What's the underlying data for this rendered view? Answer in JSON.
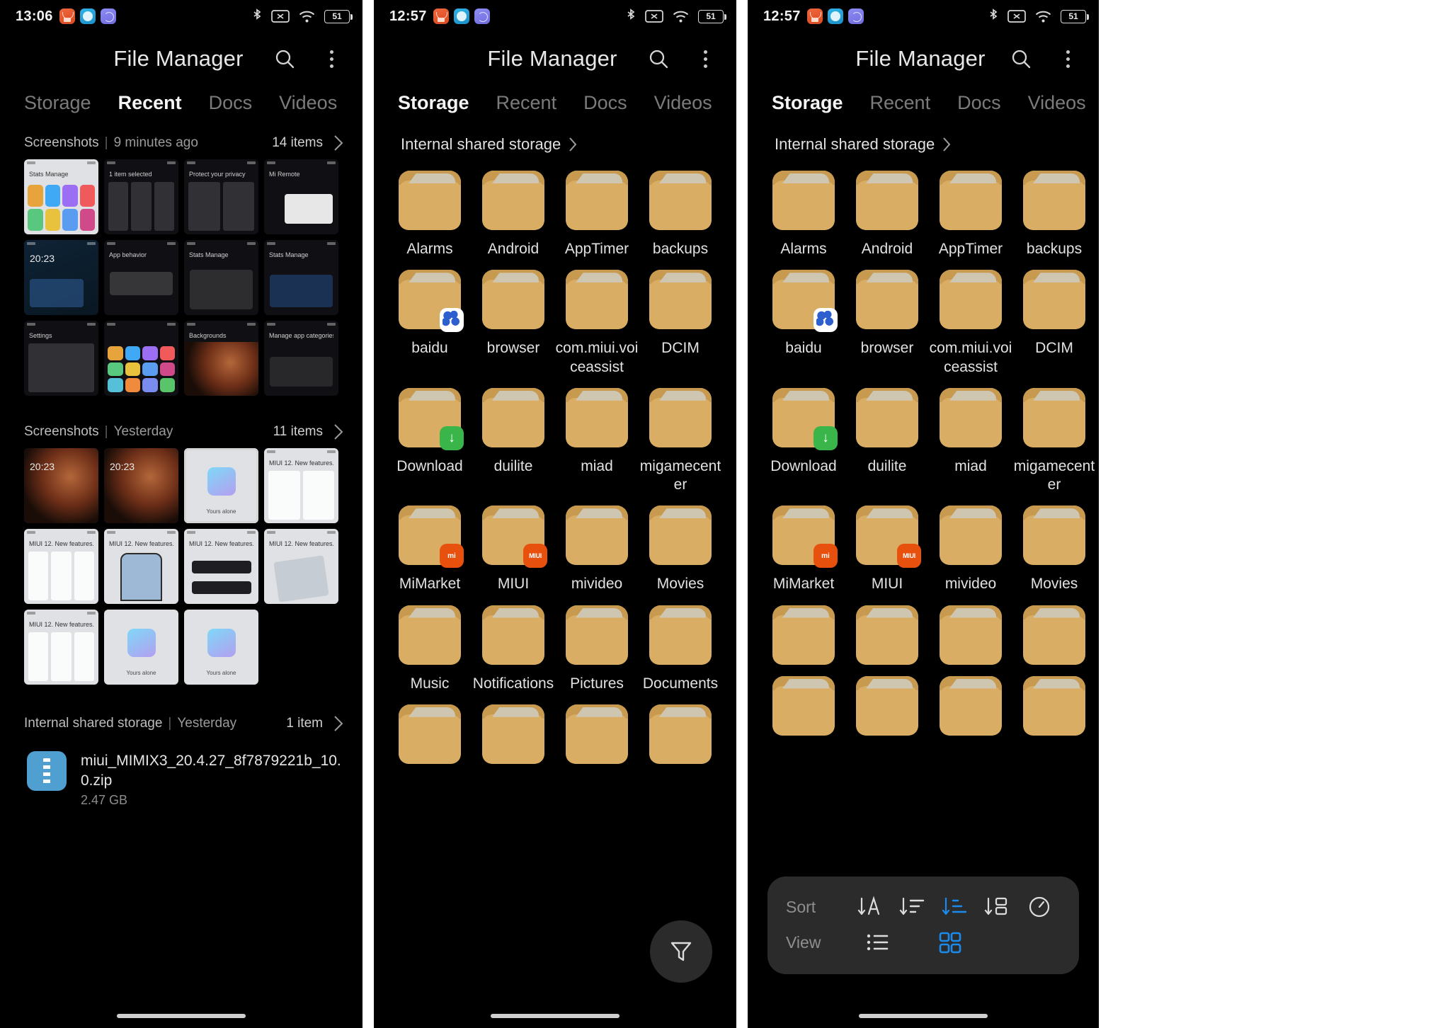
{
  "app": {
    "title": "File Manager"
  },
  "colors": {
    "accent": "#1a8cf0",
    "folder": "#d8ab60",
    "background": "#000000",
    "text": "#e8e8e8"
  },
  "panels": [
    {
      "id": "recent",
      "status": {
        "time": "13:06",
        "battery": "51",
        "icons": [
          "mail-icon",
          "browser-icon",
          "compass-icon",
          "bluetooth-icon",
          "no-sim-icon",
          "wifi-icon",
          "battery-icon"
        ]
      },
      "tabs": [
        {
          "label": "Storage",
          "active": false
        },
        {
          "label": "Recent",
          "active": true
        },
        {
          "label": "Docs",
          "active": false
        },
        {
          "label": "Videos",
          "active": false
        }
      ],
      "sections": [
        {
          "label": "Screenshots",
          "time": "9 minutes ago",
          "count": "14 items"
        },
        {
          "label": "Screenshots",
          "time": "Yesterday",
          "count": "11 items"
        },
        {
          "label": "Internal shared storage",
          "time": "Yesterday",
          "count": "1 item"
        }
      ],
      "file": {
        "name": "miui_MIMIX3_20.4.27_8f7879221b_10.0.zip",
        "size": "2.47 GB",
        "icon": "zip-file-icon"
      },
      "thumb_captions": {
        "a": "MIUI 12. New features.",
        "b": "Mi Remote",
        "c": "1 item selected",
        "d": "Manage app categories",
        "e": "Stats  Manage",
        "f": "App behavior",
        "g": "Backgrounds",
        "h": "Settings",
        "i": "Protect your privacy",
        "j": "20:23",
        "k": "Yours alone"
      }
    },
    {
      "id": "storage",
      "status": {
        "time": "12:57",
        "battery": "51"
      },
      "tabs": [
        {
          "label": "Storage",
          "active": true
        },
        {
          "label": "Recent",
          "active": false
        },
        {
          "label": "Docs",
          "active": false
        },
        {
          "label": "Videos",
          "active": false
        }
      ],
      "breadcrumb": "Internal shared storage",
      "fab": "filter-icon",
      "folders": [
        {
          "name": "Alarms",
          "badge": null
        },
        {
          "name": "Android",
          "badge": null
        },
        {
          "name": "AppTimer",
          "badge": null
        },
        {
          "name": "backups",
          "badge": null
        },
        {
          "name": "baidu",
          "badge": "baidu"
        },
        {
          "name": "browser",
          "badge": null
        },
        {
          "name": "com.miui.voiceassist",
          "badge": null
        },
        {
          "name": "DCIM",
          "badge": null
        },
        {
          "name": "Download",
          "badge": "download"
        },
        {
          "name": "duilite",
          "badge": null
        },
        {
          "name": "miad",
          "badge": null
        },
        {
          "name": "migamecenter",
          "badge": null
        },
        {
          "name": "MiMarket",
          "badge": "mi"
        },
        {
          "name": "MIUI",
          "badge": "miui"
        },
        {
          "name": "mivideo",
          "badge": null
        },
        {
          "name": "Movies",
          "badge": null
        },
        {
          "name": "Music",
          "badge": null
        },
        {
          "name": "Notifications",
          "badge": null
        },
        {
          "name": "Pictures",
          "badge": null
        },
        {
          "name": "Documents",
          "badge": null
        },
        {
          "name": "",
          "badge": null
        },
        {
          "name": "",
          "badge": null
        },
        {
          "name": "",
          "badge": null
        },
        {
          "name": "",
          "badge": null
        }
      ]
    },
    {
      "id": "storage-sort",
      "status": {
        "time": "12:57",
        "battery": "51"
      },
      "tabs": [
        {
          "label": "Storage",
          "active": true
        },
        {
          "label": "Recent",
          "active": false
        },
        {
          "label": "Docs",
          "active": false
        },
        {
          "label": "Videos",
          "active": false
        }
      ],
      "breadcrumb": "Internal shared storage",
      "folders": [
        {
          "name": "Alarms",
          "badge": null
        },
        {
          "name": "Android",
          "badge": null
        },
        {
          "name": "AppTimer",
          "badge": null
        },
        {
          "name": "backups",
          "badge": null
        },
        {
          "name": "baidu",
          "badge": "baidu"
        },
        {
          "name": "browser",
          "badge": null
        },
        {
          "name": "com.miui.voiceassist",
          "badge": null
        },
        {
          "name": "DCIM",
          "badge": null
        },
        {
          "name": "Download",
          "badge": "download"
        },
        {
          "name": "duilite",
          "badge": null
        },
        {
          "name": "miad",
          "badge": null
        },
        {
          "name": "migamecenter",
          "badge": null
        },
        {
          "name": "MiMarket",
          "badge": "mi"
        },
        {
          "name": "MIUI",
          "badge": "miui"
        },
        {
          "name": "mivideo",
          "badge": null
        },
        {
          "name": "Movies",
          "badge": null
        },
        {
          "name": "",
          "badge": null
        },
        {
          "name": "",
          "badge": null
        },
        {
          "name": "",
          "badge": null
        },
        {
          "name": "",
          "badge": null
        }
      ],
      "popup": {
        "sort_label": "Sort",
        "view_label": "View",
        "sort_options": [
          {
            "name": "sort-by-name-icon",
            "selected": false
          },
          {
            "name": "sort-by-size-icon",
            "selected": false
          },
          {
            "name": "sort-by-type-icon",
            "selected": true
          },
          {
            "name": "sort-by-group-icon",
            "selected": false
          },
          {
            "name": "sort-by-time-icon",
            "selected": false
          }
        ],
        "view_options": [
          {
            "name": "list-view-icon",
            "selected": false
          },
          {
            "name": "grid-view-icon",
            "selected": true
          }
        ]
      }
    }
  ]
}
